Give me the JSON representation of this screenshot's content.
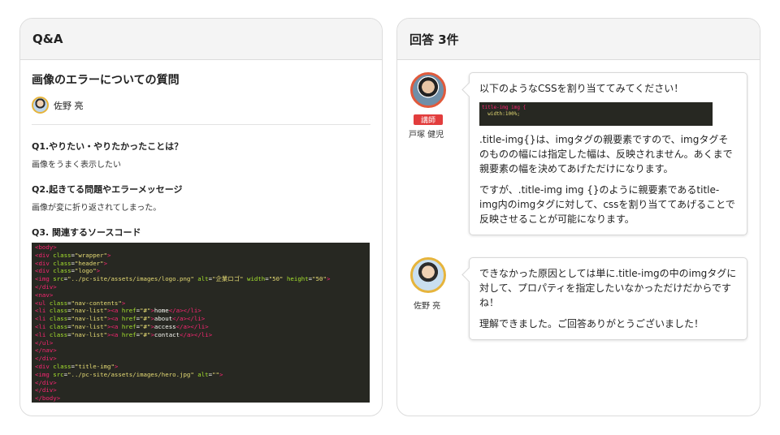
{
  "left_panel": {
    "header": "Q&A",
    "question_title": "画像のエラーについての質問",
    "author": "佐野 亮",
    "q1_label": "Q1.やりたい・やりたかったことは？",
    "q1_text": "画像をうまく表示したい",
    "q2_label": "Q2.起きてる問題やエラーメッセージ",
    "q2_text": "画像が変に折り返されてしまった。",
    "q3_label": "Q3. 関連するソースコード",
    "code_lines": [
      "<body>",
      "  <div class=\"wrapper\">",
      "    <div class=\"header\">",
      "      <div class=\"logo\">",
      "        <img src=\"../pc-site/assets/images/logo.png\" alt=\"企業ロゴ\" width=\"50\" height=\"50\">",
      "      </div>",
      "      <nav>",
      "        <ul class=\"nav-contents\">",
      "          <li class=\"nav-list\"><a href=\"#\">home</a></li>",
      "          <li class=\"nav-list\"><a href=\"#\">about</a></li>",
      "          <li class=\"nav-list\"><a href=\"#\">access</a></li>",
      "          <li class=\"nav-list\"><a href=\"#\">contact</a></li>",
      "        </ul>",
      "      </nav>",
      "    </div>",
      "    <div class=\"title-img\">",
      "      <img src=\"../pc-site/assets/images/hero.jpg\" alt=\"\">",
      "    </div>",
      "  </div>",
      "</body>"
    ]
  },
  "right_panel": {
    "header": "回答 3件",
    "answer1": {
      "badge": "講師",
      "name": "戸塚 健児",
      "p1": "以下のようなCSSを割り当ててみてください！",
      "code_line1": "title-img img {",
      "code_line2": "  width:100%;",
      "p2": ".title-img{}は、imgタグの親要素ですので、imgタグそのものの幅には指定した幅は、反映されません。あくまで親要素の幅を決めてあげただけになります。",
      "p3": "ですが、.title-img img {}のように親要素であるtitle-img内のimgタグに対して、cssを割り当ててあげることで反映させることが可能になります。"
    },
    "answer2": {
      "name": "佐野 亮",
      "p1": "できなかった原因としては単に.title-imgの中のimgタグに対して、プロパティを指定したいなかっただけだからですね！",
      "p2": "理解できました。ご回答ありがとうございました！"
    }
  }
}
